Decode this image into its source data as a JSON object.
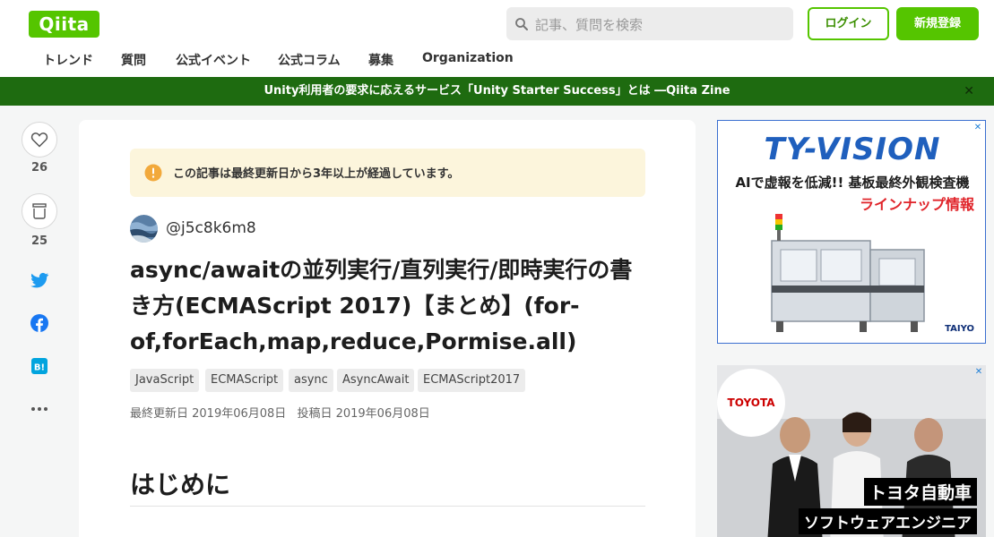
{
  "header": {
    "logo_text": "Qiita",
    "search_placeholder": "記事、質問を検索",
    "login_label": "ログイン",
    "signup_label": "新規登録",
    "brand_color": "#55c500"
  },
  "nav": {
    "items": [
      {
        "label": "トレンド"
      },
      {
        "label": "質問"
      },
      {
        "label": "公式イベント"
      },
      {
        "label": "公式コラム"
      },
      {
        "label": "募集"
      },
      {
        "label": "Organization"
      }
    ]
  },
  "banner": {
    "text": "Unity利用者の要求に応えるサービス「Unity Starter Success」とは ―Qiita Zine",
    "close_icon": "close-icon",
    "background_color": "#1e6b10"
  },
  "actions": {
    "like_count": "26",
    "stock_count": "25",
    "icons": [
      "heart-icon",
      "stock-icon",
      "twitter-icon",
      "facebook-icon",
      "hatena-bookmark-icon",
      "more-icon"
    ]
  },
  "article": {
    "notice": "この記事は最終更新日から3年以上が経過しています。",
    "author": "@j5c8k6m8",
    "title": "async/awaitの並列実行/直列実行/即時実行の書き方(ECMAScript 2017)【まとめ】(for-of,forEach,map,reduce,Pormise.all)",
    "tags": [
      "JavaScript",
      "ECMAScript",
      "async",
      "AsyncAwait",
      "ECMAScript2017"
    ],
    "updated": "最終更新日 2019年06月08日",
    "posted": "投稿日 2019年06月08日",
    "heading": "はじめに"
  },
  "ads": {
    "ad1": {
      "brand": "TY-VISION",
      "line1": "AIで虚報を低減!! 基板最終外観検査機",
      "line2": "ラインナップ情報",
      "logo": "TAIYO"
    },
    "ad2": {
      "badge": "TOYOTA",
      "caption1": "トヨタ自動車",
      "caption2": "ソフトウェアエンジニア"
    }
  }
}
